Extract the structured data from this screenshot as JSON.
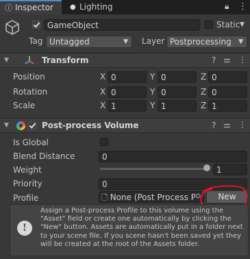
{
  "tabs": [
    {
      "label": "Inspector",
      "active": true
    },
    {
      "label": "Lighting",
      "active": false
    }
  ],
  "object": {
    "name": "GameObject",
    "static_label": "Static",
    "tag_label": "Tag",
    "tag_value": "Untagged",
    "layer_label": "Layer",
    "layer_value": "Postprocessing"
  },
  "transform": {
    "title": "Transform",
    "rows": [
      {
        "label": "Position",
        "x": "0",
        "y": "0",
        "z": "0"
      },
      {
        "label": "Rotation",
        "x": "0",
        "y": "0",
        "z": "0"
      },
      {
        "label": "Scale",
        "x": "1",
        "y": "1",
        "z": "1"
      }
    ],
    "axes": [
      "X",
      "Y",
      "Z"
    ]
  },
  "volume": {
    "title": "Post-process Volume",
    "is_global_label": "Is Global",
    "is_global": false,
    "blend_label": "Blend Distance",
    "blend_value": "0",
    "weight_label": "Weight",
    "weight_value": "1",
    "weight_fraction": 1,
    "priority_label": "Priority",
    "priority_value": "0",
    "profile_label": "Profile",
    "profile_value": "None (Post Process Pr",
    "new_button": "New",
    "help_text": "Assign a Post-process Profile to this volume using the \"Asset\" field or create one automatically by clicking the \"New\" button. Assets are automatically put in a folder next to your scene file. If you scene hasn't been saved yet they will be created at the root of the Assets folder."
  },
  "colors": {
    "background": "#383838",
    "annotation": "#e0142a",
    "tab_accent": "#4a90d9"
  }
}
